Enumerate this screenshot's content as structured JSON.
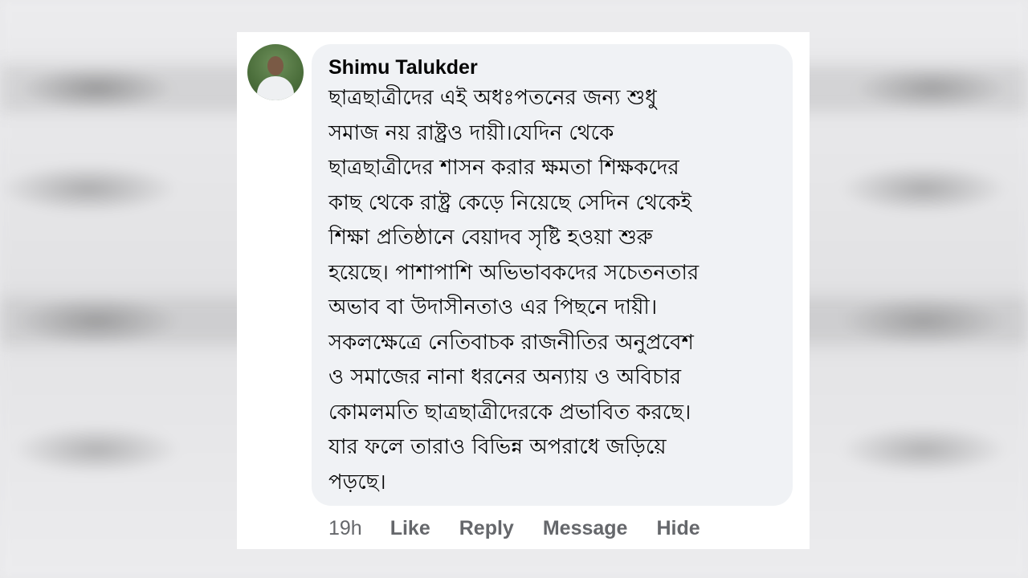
{
  "comment": {
    "author": "Shimu Talukder",
    "lines": [
      "ছাত্রছাত্রীদের এই অধঃপতনের জন্য শুধু",
      "সমাজ নয় রাষ্ট্রও দায়ী।যেদিন থেকে",
      "ছাত্রছাত্রীদের শাসন করার ক্ষমতা শিক্ষকদের",
      "কাছ থেকে রাষ্ট্র কেড়ে নিয়েছে সেদিন থেকেই",
      "শিক্ষা প্রতিষ্ঠানে বেয়াদব সৃষ্টি হওয়া শুরু",
      "হয়েছে। পাশাপাশি অভিভাবকদের সচেতনতার",
      "অভাব বা উদাসীনতাও এর পিছনে দায়ী।",
      "সকলক্ষেত্রে নেতিবাচক রাজনীতির অনুপ্রবেশ",
      "ও সমাজের নানা ধরনের অন্যায় ও অবিচার",
      "কোমলমতি ছাত্রছাত্রীদেরকে প্রভাবিত করছে।",
      "যার ফলে তারাও বিভিন্ন অপরাধে জড়িয়ে",
      "পড়ছে।"
    ]
  },
  "actions": {
    "time": "19h",
    "like": "Like",
    "reply": "Reply",
    "message": "Message",
    "hide": "Hide"
  },
  "icons": {
    "avatar": "user-avatar"
  }
}
